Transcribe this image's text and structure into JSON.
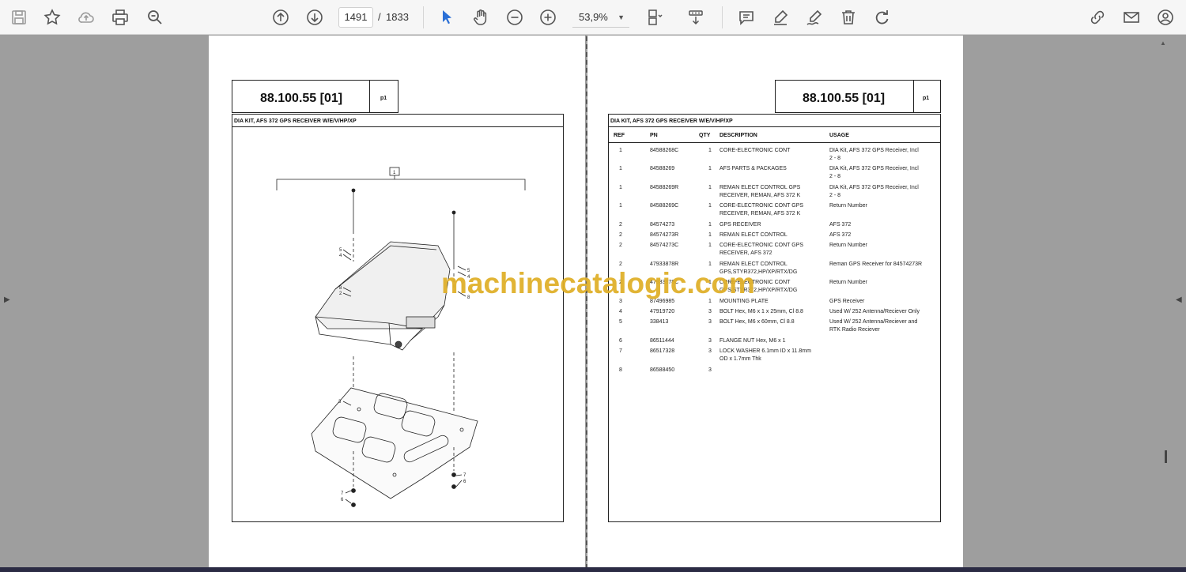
{
  "toolbar": {
    "page_current": "1491",
    "page_separator": "/",
    "page_total": "1833",
    "zoom": "53,9%"
  },
  "watermark": "machinecatalogic.com",
  "left_page": {
    "code": "88.100.55 [01]",
    "p_label": "p1",
    "title": "DIA KIT, AFS 372 GPS RECEIVER W/E/V/HP/XP",
    "callouts": [
      "1",
      "5",
      "4",
      "8",
      "2",
      "5",
      "4",
      "8",
      "3",
      "7",
      "6",
      "7",
      "6"
    ]
  },
  "right_page": {
    "code": "88.100.55 [01]",
    "p_label": "p1",
    "title": "DIA KIT, AFS 372 GPS RECEIVER W/E/V/HP/XP",
    "columns": [
      "REF",
      "PN",
      "QTY",
      "DESCRIPTION",
      "USAGE"
    ],
    "rows": [
      {
        "ref": "1",
        "pn": "84588268C",
        "qty": "1",
        "desc": [
          "CORE-ELECTRONIC CONT"
        ],
        "usage": [
          "DIA Kit, AFS 372 GPS Receiver, Incl",
          "2 - 8"
        ]
      },
      {
        "ref": "1",
        "pn": "84588269",
        "qty": "1",
        "desc": [
          "AFS PARTS & PACKAGES"
        ],
        "usage": [
          "DIA Kit, AFS 372 GPS Receiver, Incl",
          "2 - 8"
        ]
      },
      {
        "ref": "1",
        "pn": "84588269R",
        "qty": "1",
        "desc": [
          "REMAN ELECT CONTROL GPS",
          "RECEIVER, REMAN, AFS 372 K"
        ],
        "usage": [
          "DIA Kit, AFS 372 GPS Receiver, Incl",
          "2 - 8"
        ]
      },
      {
        "ref": "1",
        "pn": "84588269C",
        "qty": "1",
        "desc": [
          "CORE-ELECTRONIC CONT GPS",
          "RECEIVER, REMAN, AFS 372 K"
        ],
        "usage": [
          "Return Number"
        ]
      },
      {
        "ref": "2",
        "pn": "84574273",
        "qty": "1",
        "desc": [
          "GPS RECEIVER"
        ],
        "usage": [
          "AFS 372"
        ]
      },
      {
        "ref": "2",
        "pn": "84574273R",
        "qty": "1",
        "desc": [
          "REMAN ELECT CONTROL"
        ],
        "usage": [
          "AFS 372"
        ]
      },
      {
        "ref": "2",
        "pn": "84574273C",
        "qty": "1",
        "desc": [
          "CORE-ELECTRONIC CONT GPS",
          "RECEIVER, AFS 372"
        ],
        "usage": [
          "Return Number"
        ]
      },
      {
        "ref": "2",
        "pn": "47933878R",
        "qty": "1",
        "desc": [
          "REMAN ELECT CONTROL",
          "GPS,STYR372,HP/XP/RTX/DG"
        ],
        "usage": [
          "Reman GPS Receiver for 84574273R"
        ]
      },
      {
        "ref": "2",
        "pn": "47933878C",
        "qty": "1",
        "desc": [
          "CORE-ELECTRONIC CONT",
          "GPS,STYR372,HP/XP/RTX/DG"
        ],
        "usage": [
          "Return Number"
        ]
      },
      {
        "ref": "3",
        "pn": "87496985",
        "qty": "1",
        "desc": [
          "MOUNTING PLATE"
        ],
        "usage": [
          "GPS Receiver"
        ]
      },
      {
        "ref": "4",
        "pn": "47919720",
        "qty": "3",
        "desc": [
          "BOLT Hex, M6 x 1 x 25mm, Cl 8.8"
        ],
        "usage": [
          "Used W/ 252 Antenna/Reciever Only"
        ]
      },
      {
        "ref": "5",
        "pn": "338413",
        "qty": "3",
        "desc": [
          "BOLT Hex, M6 x 60mm, Cl 8.8"
        ],
        "usage": [
          "Used W/ 252 Antenna/Reciever and",
          "RTK Radio Reciever"
        ]
      },
      {
        "ref": "6",
        "pn": "86511444",
        "qty": "3",
        "desc": [
          "FLANGE NUT Hex, M6 x 1"
        ],
        "usage": []
      },
      {
        "ref": "7",
        "pn": "86517328",
        "qty": "3",
        "desc": [
          "LOCK WASHER 6.1mm ID x 11.8mm",
          "OD x 1.7mm Thk"
        ],
        "usage": []
      },
      {
        "ref": "8",
        "pn": "86588450",
        "qty": "3",
        "desc": [],
        "usage": []
      }
    ]
  }
}
